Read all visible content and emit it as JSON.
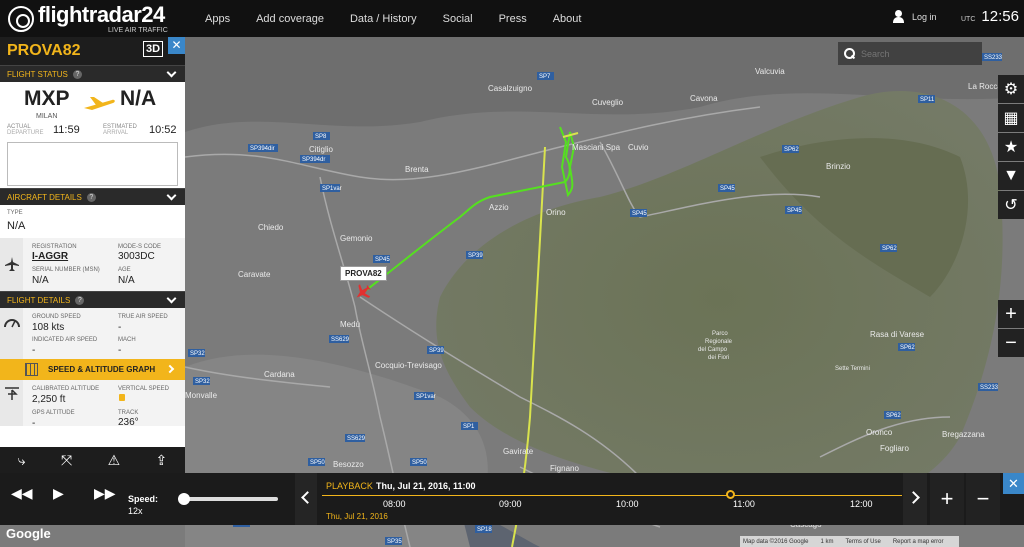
{
  "brand": {
    "name": "flightradar24",
    "tagline": "LIVE AIR TRAFFIC"
  },
  "nav": [
    "Apps",
    "Add coverage",
    "Data / History",
    "Social",
    "Press",
    "About"
  ],
  "login_label": "Log in",
  "clock": {
    "zone": "UTC",
    "time": "12:56"
  },
  "search": {
    "placeholder": "Search"
  },
  "flight": {
    "callsign": "PROVA82",
    "view_3d": "3D",
    "status_header": "FLIGHT STATUS",
    "origin": "MXP",
    "origin_city": "MILAN",
    "destination": "N/A",
    "actual_label": "ACTUAL",
    "departure_label": "DEPARTURE",
    "actual_departure": "11:59",
    "estimated_label": "ESTIMATED",
    "arrival_label": "ARRIVAL",
    "estimated_arrival": "10:52"
  },
  "aircraft": {
    "header": "AIRCRAFT DETAILS",
    "type_label": "TYPE",
    "type": "N/A",
    "registration_label": "REGISTRATION",
    "registration": "I-AGGR",
    "modes_label": "MODE-S CODE",
    "modes": "3003DC",
    "serial_label": "SERIAL NUMBER (MSN)",
    "serial": "N/A",
    "age_label": "AGE",
    "age": "N/A"
  },
  "details": {
    "header": "FLIGHT DETAILS",
    "ground_speed_label": "GROUND SPEED",
    "ground_speed": "108 kts",
    "true_air_speed_label": "TRUE AIR SPEED",
    "true_air_speed": "-",
    "indicated_label": "INDICATED AIR SPEED",
    "indicated": "-",
    "mach_label": "MACH",
    "mach": "-",
    "graph_button": "SPEED & ALTITUDE GRAPH",
    "cal_alt_label": "CALIBRATED ALTITUDE",
    "cal_alt": "2,250 ft",
    "vertical_label": "VERTICAL SPEED",
    "gps_alt_label": "GPS ALTITUDE",
    "gps_alt": "-",
    "track_label": "TRACK",
    "track": "236°"
  },
  "playback": {
    "label": "PLAYBACK",
    "datetime": "Thu, Jul 21, 2016, 11:00",
    "day": "Thu, Jul 21, 2016",
    "speed_label": "Speed:",
    "speed": "12x",
    "ticks": [
      "08:00",
      "09:00",
      "10:00",
      "11:00",
      "12:00"
    ]
  },
  "map_labels": {
    "plane_label": "PROVA82",
    "places": [
      "Valcuvia",
      "Casalzuigno",
      "Cuveglio",
      "Cavona",
      "Masciani Spa",
      "Cuvio",
      "Citiglio",
      "Brenta",
      "Azzio",
      "Orino",
      "Brinzio",
      "Chiedo",
      "Gemonio",
      "Caravate",
      "Medù",
      "Cardana",
      "Cocquio-Trevisago",
      "Monvalle",
      "Besozzo",
      "Gavirate",
      "Fignano",
      "Oronco",
      "Bregazzana",
      "Fogliaro",
      "Rasa di Varese",
      "La Rocca",
      "Cascago",
      "Parco Regionale del Campo dei Fiori",
      "Sette Termini"
    ],
    "roads": [
      "SP7",
      "SP8",
      "SP394dir",
      "SP394dr",
      "SP1var",
      "SP45",
      "SP39",
      "SP62",
      "SP11",
      "SS233",
      "SS629",
      "SP32",
      "SP50",
      "SP1",
      "SP18",
      "SS629",
      "SP45",
      "SP62"
    ]
  },
  "attribution": {
    "google": "Google",
    "items": [
      "Map data ©2016 Google",
      "1 km",
      "Terms of Use",
      "Report a map error"
    ]
  }
}
